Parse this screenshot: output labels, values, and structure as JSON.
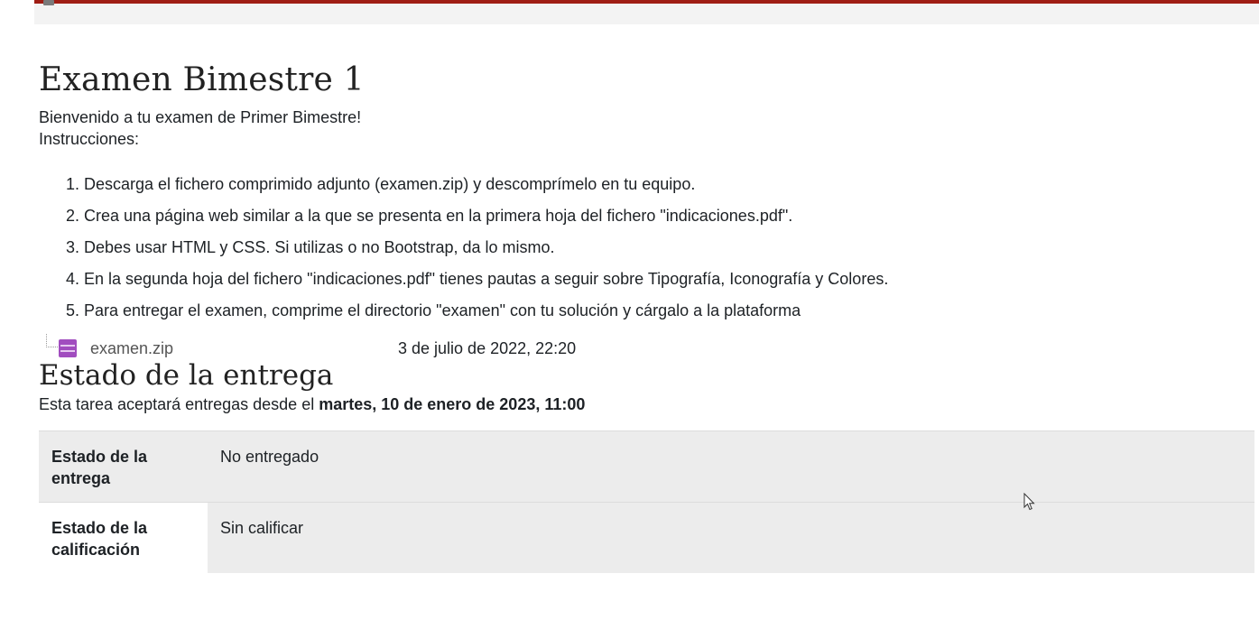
{
  "page": {
    "title": "Examen Bimestre 1",
    "welcome": "Bienvenido a tu examen de Primer Bimestre!",
    "instructions_label": "Instrucciones:",
    "steps": [
      "Descarga el fichero comprimido adjunto (examen.zip) y descomprímelo en tu equipo.",
      "Crea una página web similar a la que se presenta en la primera hoja del fichero \"indicaciones.pdf\".",
      "Debes usar HTML y CSS. Si utilizas o no Bootstrap, da lo mismo.",
      "En la segunda hoja del fichero \"indicaciones.pdf\" tienes pautas a seguir sobre Tipografía, Iconografía y Colores.",
      "Para entregar el examen, comprime el directorio \"examen\" con tu solución y cárgalo a la plataforma"
    ],
    "attachment": {
      "icon": "zip-file-icon",
      "name": "examen.zip",
      "date": "3 de julio de 2022, 22:20"
    }
  },
  "submission": {
    "heading": "Estado de la entrega",
    "accept_prefix": "Esta tarea aceptará entregas desde el ",
    "accept_date": "martes, 10 de enero de 2023, 11:00",
    "rows": [
      {
        "label": "Estado de la entrega",
        "value": "No entregado"
      },
      {
        "label": "Estado de la calificación",
        "value": "Sin calificar"
      }
    ]
  },
  "colors": {
    "accent_bar": "#9f1d14",
    "zip_icon": "#a14dbf",
    "table_bg": "#ececec"
  }
}
